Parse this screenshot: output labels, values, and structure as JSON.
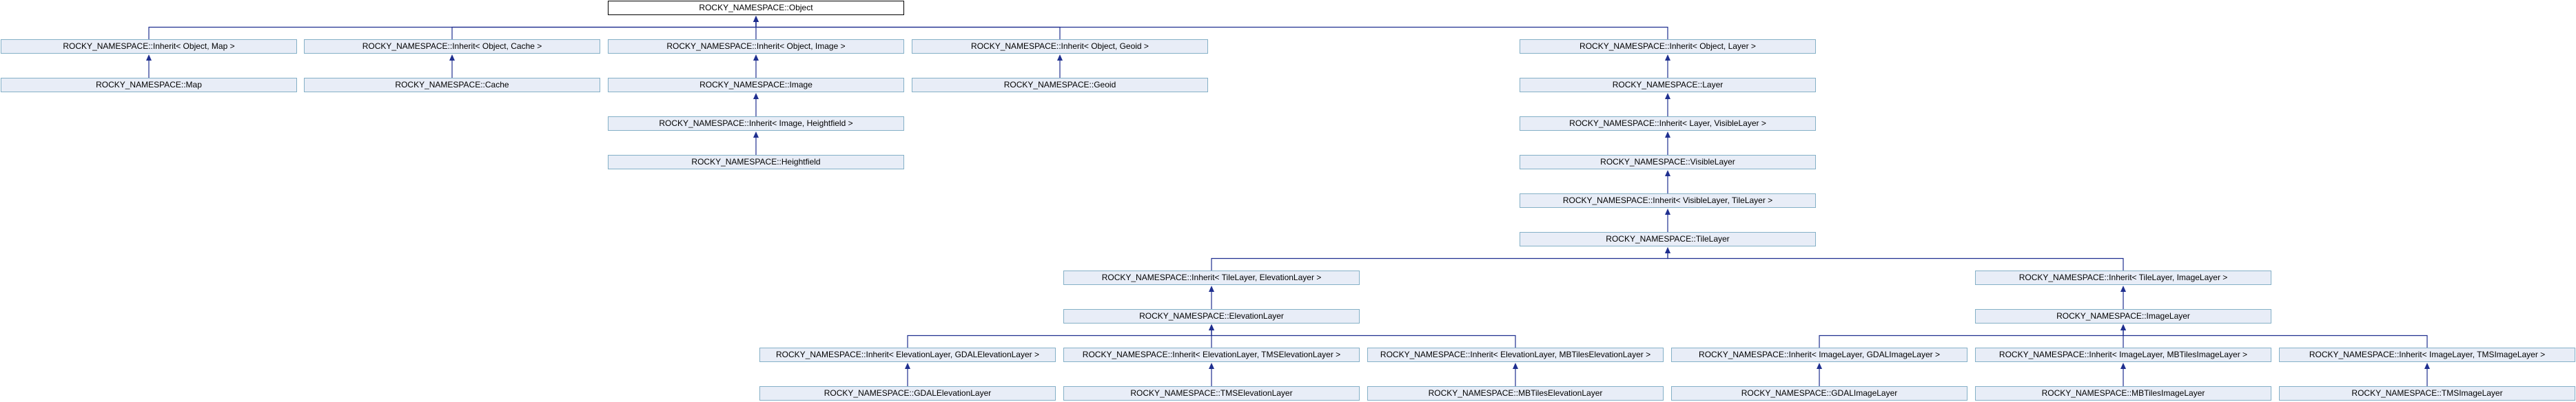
{
  "nodes": [
    {
      "id": "object",
      "label": "ROCKY_NAMESPACE::Object",
      "root": true
    },
    {
      "id": "inherit-object-map",
      "label": "ROCKY_NAMESPACE::Inherit< Object, Map >"
    },
    {
      "id": "inherit-object-cache",
      "label": "ROCKY_NAMESPACE::Inherit< Object, Cache >"
    },
    {
      "id": "inherit-object-image",
      "label": "ROCKY_NAMESPACE::Inherit< Object, Image >"
    },
    {
      "id": "inherit-object-geoid",
      "label": "ROCKY_NAMESPACE::Inherit< Object, Geoid >"
    },
    {
      "id": "inherit-object-layer",
      "label": "ROCKY_NAMESPACE::Inherit< Object, Layer >"
    },
    {
      "id": "map",
      "label": "ROCKY_NAMESPACE::Map"
    },
    {
      "id": "cache",
      "label": "ROCKY_NAMESPACE::Cache"
    },
    {
      "id": "image",
      "label": "ROCKY_NAMESPACE::Image"
    },
    {
      "id": "geoid",
      "label": "ROCKY_NAMESPACE::Geoid"
    },
    {
      "id": "layer",
      "label": "ROCKY_NAMESPACE::Layer"
    },
    {
      "id": "inherit-image-heightfield",
      "label": "ROCKY_NAMESPACE::Inherit< Image, Heightfield >"
    },
    {
      "id": "inherit-layer-visiblelayer",
      "label": "ROCKY_NAMESPACE::Inherit< Layer, VisibleLayer >"
    },
    {
      "id": "heightfield",
      "label": "ROCKY_NAMESPACE::Heightfield"
    },
    {
      "id": "visiblelayer",
      "label": "ROCKY_NAMESPACE::VisibleLayer"
    },
    {
      "id": "inherit-visiblelayer-tilelayer",
      "label": "ROCKY_NAMESPACE::Inherit< VisibleLayer, TileLayer >"
    },
    {
      "id": "tilelayer",
      "label": "ROCKY_NAMESPACE::TileLayer"
    },
    {
      "id": "inherit-tilelayer-elevationlayer",
      "label": "ROCKY_NAMESPACE::Inherit< TileLayer, ElevationLayer >"
    },
    {
      "id": "inherit-tilelayer-imagelayer",
      "label": "ROCKY_NAMESPACE::Inherit< TileLayer, ImageLayer >"
    },
    {
      "id": "elevationlayer",
      "label": "ROCKY_NAMESPACE::ElevationLayer"
    },
    {
      "id": "imagelayer",
      "label": "ROCKY_NAMESPACE::ImageLayer"
    },
    {
      "id": "inherit-elevationlayer-gdalelevationlayer",
      "label": "ROCKY_NAMESPACE::Inherit< ElevationLayer, GDALElevationLayer >"
    },
    {
      "id": "inherit-elevationlayer-tmselevationlayer",
      "label": "ROCKY_NAMESPACE::Inherit< ElevationLayer, TMSElevationLayer >"
    },
    {
      "id": "inherit-elevationlayer-mbtileselevationlayer",
      "label": "ROCKY_NAMESPACE::Inherit< ElevationLayer, MBTilesElevationLayer >"
    },
    {
      "id": "inherit-imagelayer-gdalimagelayer",
      "label": "ROCKY_NAMESPACE::Inherit< ImageLayer, GDALImageLayer >"
    },
    {
      "id": "inherit-imagelayer-mbtilesimagelayer",
      "label": "ROCKY_NAMESPACE::Inherit< ImageLayer, MBTilesImageLayer >"
    },
    {
      "id": "inherit-imagelayer-tmsimagelayer",
      "label": "ROCKY_NAMESPACE::Inherit< ImageLayer, TMSImageLayer >"
    },
    {
      "id": "gdalelevationlayer",
      "label": "ROCKY_NAMESPACE::GDALElevationLayer"
    },
    {
      "id": "tmselevationlayer",
      "label": "ROCKY_NAMESPACE::TMSElevationLayer"
    },
    {
      "id": "mbtileselevationlayer",
      "label": "ROCKY_NAMESPACE::MBTilesElevationLayer"
    },
    {
      "id": "gdalimagelayer",
      "label": "ROCKY_NAMESPACE::GDALImageLayer"
    },
    {
      "id": "mbtilesimagelayer",
      "label": "ROCKY_NAMESPACE::MBTilesImageLayer"
    },
    {
      "id": "tmsimagelayer",
      "label": "ROCKY_NAMESPACE::TMSImageLayer"
    }
  ],
  "edges": [
    {
      "child": "inherit-object-map",
      "parent": "object"
    },
    {
      "child": "inherit-object-cache",
      "parent": "object"
    },
    {
      "child": "inherit-object-image",
      "parent": "object"
    },
    {
      "child": "inherit-object-geoid",
      "parent": "object"
    },
    {
      "child": "inherit-object-layer",
      "parent": "object"
    },
    {
      "child": "map",
      "parent": "inherit-object-map"
    },
    {
      "child": "cache",
      "parent": "inherit-object-cache"
    },
    {
      "child": "image",
      "parent": "inherit-object-image"
    },
    {
      "child": "geoid",
      "parent": "inherit-object-geoid"
    },
    {
      "child": "layer",
      "parent": "inherit-object-layer"
    },
    {
      "child": "inherit-image-heightfield",
      "parent": "image"
    },
    {
      "child": "heightfield",
      "parent": "inherit-image-heightfield"
    },
    {
      "child": "inherit-layer-visiblelayer",
      "parent": "layer"
    },
    {
      "child": "visiblelayer",
      "parent": "inherit-layer-visiblelayer"
    },
    {
      "child": "inherit-visiblelayer-tilelayer",
      "parent": "visiblelayer"
    },
    {
      "child": "tilelayer",
      "parent": "inherit-visiblelayer-tilelayer"
    },
    {
      "child": "inherit-tilelayer-elevationlayer",
      "parent": "tilelayer"
    },
    {
      "child": "inherit-tilelayer-imagelayer",
      "parent": "tilelayer"
    },
    {
      "child": "elevationlayer",
      "parent": "inherit-tilelayer-elevationlayer"
    },
    {
      "child": "imagelayer",
      "parent": "inherit-tilelayer-imagelayer"
    },
    {
      "child": "inherit-elevationlayer-gdalelevationlayer",
      "parent": "elevationlayer"
    },
    {
      "child": "inherit-elevationlayer-tmselevationlayer",
      "parent": "elevationlayer"
    },
    {
      "child": "inherit-elevationlayer-mbtileselevationlayer",
      "parent": "elevationlayer"
    },
    {
      "child": "inherit-imagelayer-gdalimagelayer",
      "parent": "imagelayer"
    },
    {
      "child": "inherit-imagelayer-mbtilesimagelayer",
      "parent": "imagelayer"
    },
    {
      "child": "inherit-imagelayer-tmsimagelayer",
      "parent": "imagelayer"
    },
    {
      "child": "gdalelevationlayer",
      "parent": "inherit-elevationlayer-gdalelevationlayer"
    },
    {
      "child": "tmselevationlayer",
      "parent": "inherit-elevationlayer-tmselevationlayer"
    },
    {
      "child": "mbtileselevationlayer",
      "parent": "inherit-elevationlayer-mbtileselevationlayer"
    },
    {
      "child": "gdalimagelayer",
      "parent": "inherit-imagelayer-gdalimagelayer"
    },
    {
      "child": "mbtilesimagelayer",
      "parent": "inherit-imagelayer-mbtilesimagelayer"
    },
    {
      "child": "tmsimagelayer",
      "parent": "inherit-imagelayer-tmsimagelayer"
    }
  ]
}
